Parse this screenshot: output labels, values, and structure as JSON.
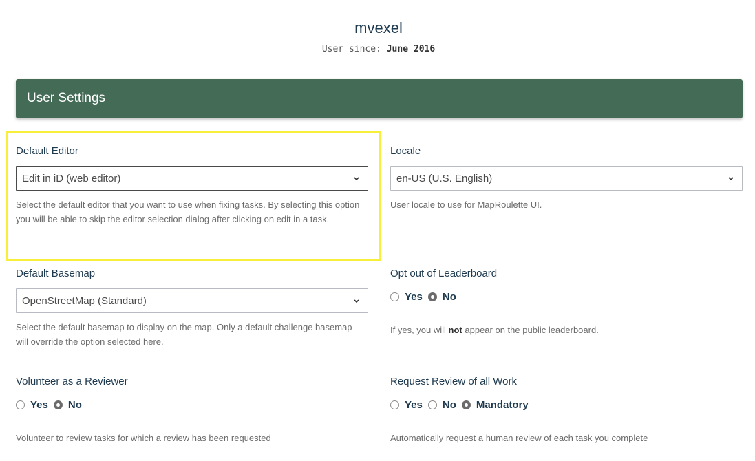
{
  "profile": {
    "username": "mvexel",
    "since_label": "User since:",
    "since_value": "June 2016"
  },
  "settings_title": "User Settings",
  "default_editor": {
    "label": "Default Editor",
    "value": "Edit in iD (web editor)",
    "help": "Select the default editor that you want to use when fixing tasks. By selecting this option you will be able to skip the editor selection dialog after clicking on edit in a task."
  },
  "locale": {
    "label": "Locale",
    "value": "en-US (U.S. English)",
    "help": "User locale to use for MapRoulette UI."
  },
  "default_basemap": {
    "label": "Default Basemap",
    "value": "OpenStreetMap (Standard)",
    "help": "Select the default basemap to display on the map. Only a default challenge basemap will override the option selected here."
  },
  "leaderboard": {
    "label": "Opt out of Leaderboard",
    "yes": "Yes",
    "no": "No",
    "selected": "No",
    "help_prefix": "If yes, you will",
    "help_bold": "not",
    "help_suffix": "appear on the public leaderboard."
  },
  "reviewer": {
    "label": "Volunteer as a Reviewer",
    "yes": "Yes",
    "no": "No",
    "selected": "No",
    "help": "Volunteer to review tasks for which a review has been requested"
  },
  "request_review": {
    "label": "Request Review of all Work",
    "yes": "Yes",
    "no": "No",
    "mandatory": "Mandatory",
    "selected": "Mandatory",
    "help": "Automatically request a human review of each task you complete"
  },
  "colors": {
    "header_bg": "#446b56",
    "highlight": "#f8ef3a"
  }
}
